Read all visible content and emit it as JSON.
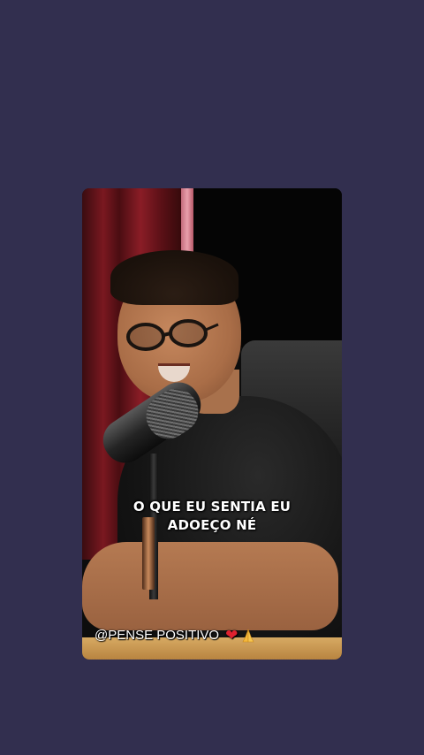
{
  "video": {
    "caption_lines": [
      "O QUE EU SENTIA EU",
      "ADOEÇO NÉ"
    ],
    "watermark_text": "@PENSE POSITIVO",
    "watermark_icons": [
      "heart-icon",
      "praying-hands-icon"
    ],
    "heart_glyph": "❤",
    "colors": {
      "page_background": "#322f4f",
      "caption_text": "#ffffff",
      "heart": "#e0212f"
    }
  }
}
